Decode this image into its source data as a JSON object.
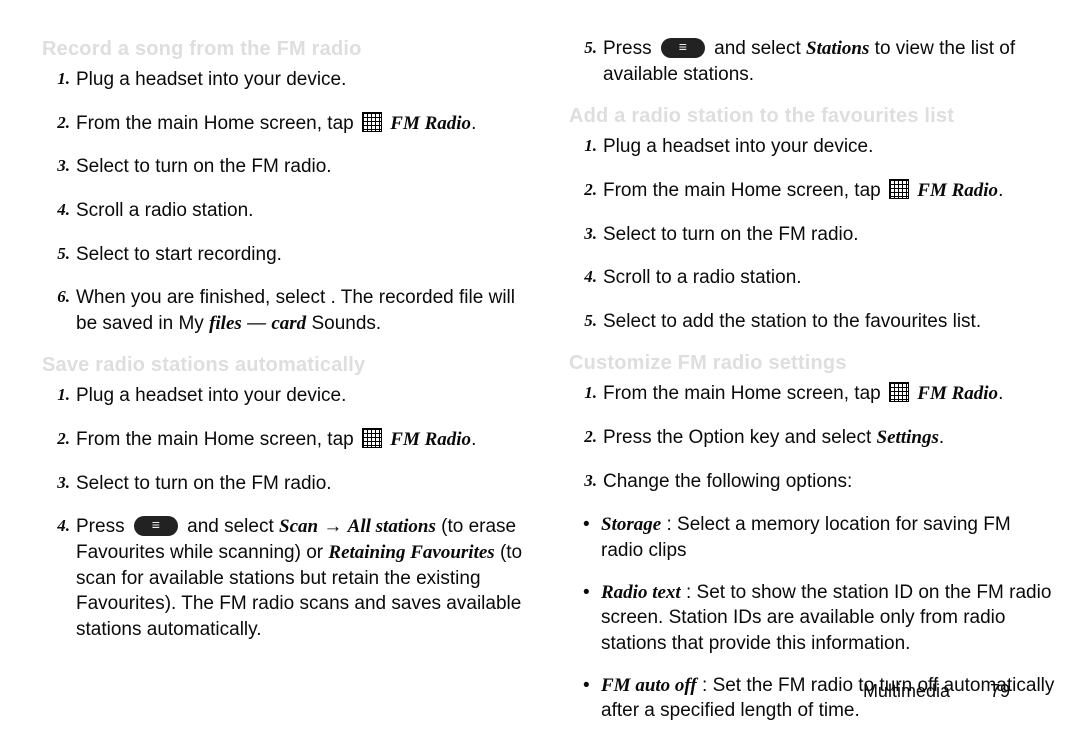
{
  "footer": {
    "section": "Multimedia",
    "page": "79"
  },
  "left": {
    "section_record": "Record a song from the FM radio",
    "record": [
      "Plug a headset into your device.",
      [
        "From the main Home screen, tap ",
        "GRID",
        " ",
        [
          "em",
          "FM Radio"
        ],
        "."
      ],
      [
        "Select ",
        " to turn on the FM radio."
      ],
      "Scroll a radio station.",
      [
        "Select ",
        " to start recording."
      ],
      [
        "When you are finished, select ",
        ". The recorded file will be saved in My ",
        [
          "em",
          "files"
        ],
        " — ",
        [
          "em",
          "card"
        ],
        " Sounds."
      ]
    ],
    "section_save": "Save radio stations automatically",
    "save": [
      "Plug a headset into your device.",
      [
        "From the main Home screen, tap ",
        "GRID",
        " ",
        [
          "em",
          "FM Radio"
        ],
        "."
      ],
      [
        "Select ",
        " to turn on the FM radio."
      ],
      [
        "Press ",
        "IBTN",
        " and select ",
        [
          "em",
          "Scan"
        ],
        " → ",
        [
          "em",
          "All stations"
        ],
        " (to erase Favourites while scanning) or ",
        [
          "em",
          "Retaining Favourites"
        ],
        " (to scan for available stations but retain the existing Favourites). The FM radio scans and saves available stations automatically."
      ]
    ]
  },
  "right": {
    "step5": [
      "Press ",
      "IBTN",
      " and select ",
      [
        "em",
        "Stations"
      ],
      " to view the list of available stations."
    ],
    "section_add": "Add a radio station to the favourites list",
    "add": [
      "Plug a headset into your device.",
      [
        "From the main Home screen, tap ",
        "GRID",
        " ",
        [
          "em",
          "FM Radio"
        ],
        "."
      ],
      [
        "Select ",
        " to turn on the FM radio."
      ],
      "Scroll to a radio station.",
      [
        "Select ",
        " to add the station to the favourites list."
      ]
    ],
    "section_customize": "Customize FM radio settings",
    "customize": [
      [
        "From the main Home screen, tap ",
        "GRID",
        " ",
        [
          "em",
          "FM Radio"
        ],
        "."
      ],
      [
        "Press the Option key and select ",
        [
          "em",
          "Settings"
        ],
        "."
      ],
      "Change the following options:"
    ],
    "options": [
      [
        [
          "em",
          "Storage"
        ],
        " : Select a memory location for saving FM radio clips"
      ],
      [
        [
          "em",
          "Radio text"
        ],
        " : Set to show the station ID on the FM radio screen. Station IDs are available only from radio stations that provide this information."
      ],
      [
        [
          "em",
          "FM auto off"
        ],
        " : Set the FM radio to turn off automatically after a specified length of time."
      ]
    ]
  }
}
